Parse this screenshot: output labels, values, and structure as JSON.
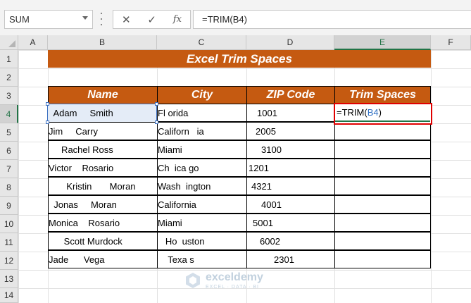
{
  "formula_bar": {
    "name_box": "SUM",
    "cancel_icon": "✕",
    "enter_icon": "✓",
    "fx_label": "fx",
    "formula": "=TRIM(B4)"
  },
  "columns": [
    "A",
    "B",
    "C",
    "D",
    "E",
    "F"
  ],
  "rows": [
    "1",
    "2",
    "3",
    "4",
    "5",
    "6",
    "7",
    "8",
    "9",
    "10",
    "11",
    "12",
    "13",
    "14"
  ],
  "sheet": {
    "title": "Excel Trim Spaces",
    "headers": [
      "Name",
      "City",
      "ZIP Code",
      "Trim Spaces"
    ],
    "names": [
      "  Adam     Smith",
      "Jim     Carry",
      "     Rachel Ross",
      "Victor    Rosario",
      "       Kristin       Moran",
      "  Jonas     Moran",
      "Monica    Rosario",
      "      Scott Murdock",
      "Jade      Vega"
    ],
    "cities": [
      "Fl orida",
      "Californ   ia",
      "Miami",
      "Ch  ica go",
      "Wash  ington",
      "California",
      "Miami",
      "   Ho  uston",
      "    Texa s"
    ],
    "zips": [
      "1001",
      "2005",
      "3100",
      "1201",
      "4321",
      "4001",
      "5001",
      "6002",
      "2301"
    ],
    "active_cell_prefix": "=TRIM(",
    "active_cell_ref": "B4",
    "active_cell_suffix": ")"
  },
  "watermark": {
    "name": "exceldemy",
    "tagline": "EXCEL · DATA · BI"
  },
  "colors": {
    "header_fill": "#c55a11",
    "highlight_border": "#e00000",
    "ref_blue": "#2f6fc3"
  }
}
